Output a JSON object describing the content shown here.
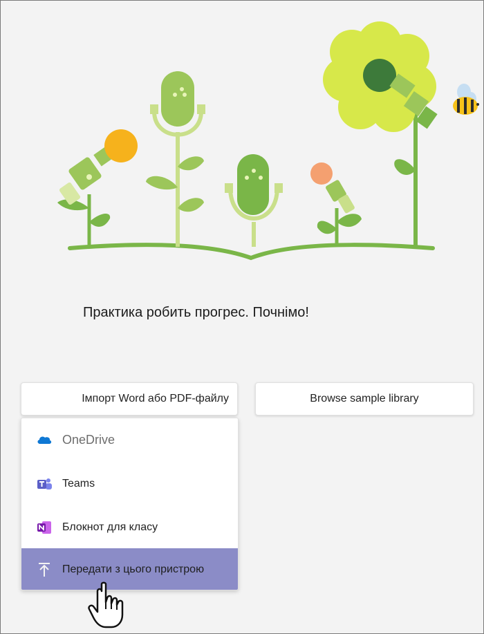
{
  "tagline": "Практика робить прогрес. Почнімо!",
  "buttons": {
    "import_label": "Імпорт Word або PDF-файлу",
    "browse_label": "Browse sample library"
  },
  "menu": {
    "items": [
      {
        "label": "OneDrive",
        "icon": "onedrive-icon"
      },
      {
        "label": "Teams",
        "icon": "teams-icon"
      },
      {
        "label": "Блокнот для класу",
        "icon": "onenote-icon"
      },
      {
        "label": "Передати з цього пристрою",
        "icon": "upload-icon",
        "highlighted": true
      }
    ]
  },
  "colors": {
    "menu_highlight": "#8b8cc7",
    "plant_green": "#7ab648",
    "flower_yellow": "#d7e84a",
    "onedrive_blue": "#0f78d4",
    "teams_purple": "#5b5fc7",
    "onenote_purple": "#7719aa"
  }
}
